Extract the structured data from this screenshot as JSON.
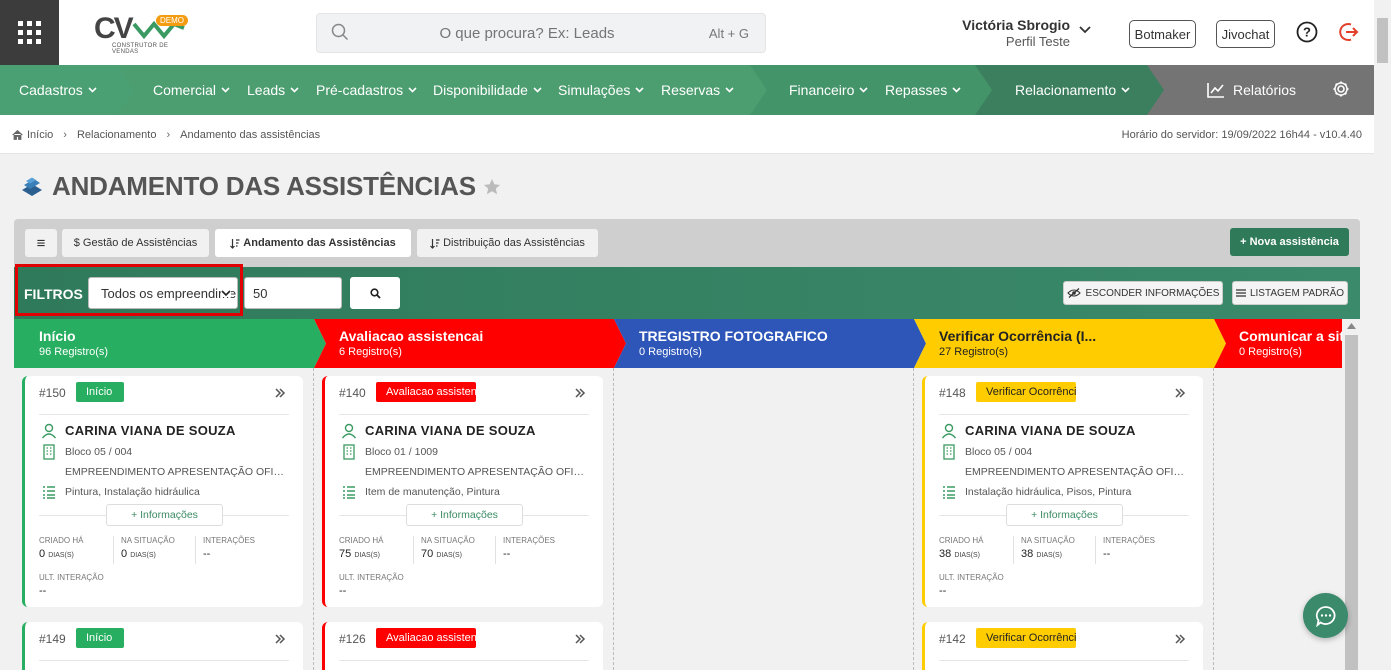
{
  "header": {
    "logo_text": "CV",
    "logo_badge": "DEMO",
    "logo_sub": "CONSTRUTOR DE VENDAS",
    "search_placeholder": "O que procura? Ex: Leads",
    "search_shortcut": "Alt + G",
    "user_name": "Victória Sbrogio",
    "user_profile": "Perfil Teste",
    "btn_botmaker": "Botmaker",
    "btn_jivochat": "Jivochat"
  },
  "nav": {
    "items": [
      "Cadastros",
      "Comercial",
      "Leads",
      "Pré-cadastros",
      "Disponibilidade",
      "Simulações",
      "Reservas",
      "Financeiro",
      "Repasses",
      "Relacionamento"
    ],
    "reports": "Relatórios"
  },
  "breadcrumb": {
    "home": "Início",
    "level1": "Relacionamento",
    "level2": "Andamento das assistências",
    "server": "Horário do servidor: 19/09/2022 16h44 - v10.4.40"
  },
  "page": {
    "title": "ANDAMENTO DAS ASSISTÊNCIAS"
  },
  "tabs": {
    "menu_icon": "≡",
    "gestao": "$ Gestão de Assistências",
    "andamento": "Andamento das Assistências",
    "distribuicao": "Distribuição das Assistências",
    "new_button": "+ Nova assistência"
  },
  "filters": {
    "label": "FILTROS",
    "select_value": "Todos os empreendimentos",
    "limit_value": "50",
    "hide_info": "ESCONDER INFORMAÇÕES",
    "default_list": "LISTAGEM PADRÃO"
  },
  "columns": [
    {
      "title": "Início",
      "count": "96 Registro(s)",
      "color": "#27ae60"
    },
    {
      "title": "Avaliacao assistencai",
      "count": "6 Registro(s)",
      "color": "#ff0000"
    },
    {
      "title": "TREGISTRO FOTOGRAFICO",
      "count": "0 Registro(s)",
      "color": "#2e56b9"
    },
    {
      "title": "Verificar Ocorrência (I...",
      "count": "27 Registro(s)",
      "color": "#ffcc00"
    },
    {
      "title": "Comunicar a sit",
      "count": "0 Registro(s)",
      "color": "#ff0000"
    }
  ],
  "labels": {
    "info_button": "+ Informações",
    "created": "CRIADO HÁ",
    "in_status": "NA SITUAÇÃO",
    "interactions": "INTERAÇÕES",
    "last_interaction": "ULT. INTERAÇÃO",
    "days": "DIAS(S)"
  },
  "cards": [
    {
      "id": "#150",
      "badge": "Início",
      "name": "CARINA VIANA DE SOUZA",
      "unit": "Bloco 05 / 004",
      "project": "EMPREENDIMENTO APRESENTAÇÃO OFICIAL",
      "items": "Pintura, Instalação hidráulica",
      "created": "0",
      "in_status": "0",
      "interactions": "--",
      "last": "--"
    },
    {
      "id": "#140",
      "badge": "Avaliacao assistencai",
      "name": "CARINA VIANA DE SOUZA",
      "unit": "Bloco 01 / 1009",
      "project": "EMPREENDIMENTO APRESENTAÇÃO OFICIAL",
      "items": "Item de manutenção, Pintura",
      "created": "75",
      "in_status": "70",
      "interactions": "--",
      "last": "--"
    },
    {
      "id": "#148",
      "badge": "Verificar Ocorrência (Interna)",
      "name": "CARINA VIANA DE SOUZA",
      "unit": "Bloco 05 / 004",
      "project": "EMPREENDIMENTO APRESENTAÇÃO OFICIAL",
      "items": "Instalação hidráulica, Pisos, Pintura",
      "created": "38",
      "in_status": "38",
      "interactions": "--",
      "last": "--"
    }
  ],
  "cards_row2": [
    {
      "id": "#149",
      "badge": "Início"
    },
    {
      "id": "#126",
      "badge": "Avaliacao assistencai"
    },
    {
      "id": "#142",
      "badge": "Verificar Ocorrência (Interna)"
    }
  ]
}
